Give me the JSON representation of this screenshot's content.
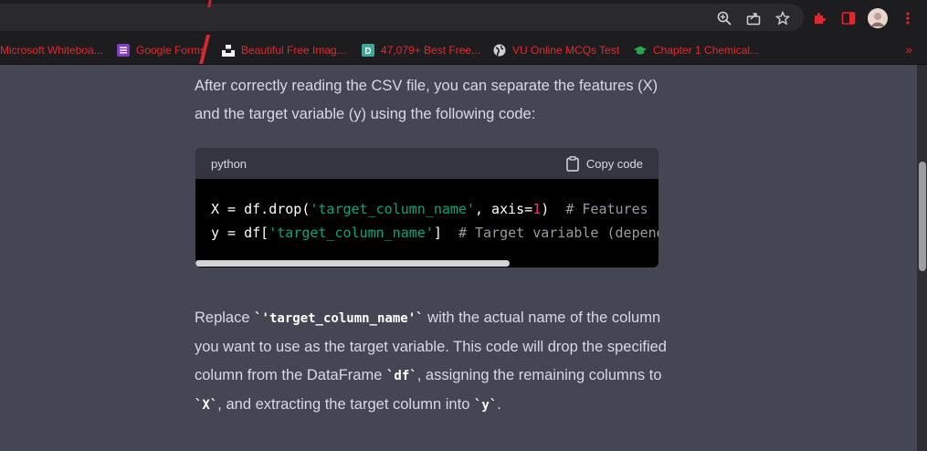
{
  "toolbar": {
    "icons": [
      "zoom-icon",
      "share-icon",
      "star-icon",
      "extension-icon",
      "sidebar-icon",
      "avatar",
      "menu-icon"
    ]
  },
  "bookmarks": [
    {
      "label": "Microsoft Whiteboa...",
      "icon": "none"
    },
    {
      "label": "Google Forms",
      "icon": "forms-icon"
    },
    {
      "label": "Beautiful Free Imag...",
      "icon": "unsplash-icon"
    },
    {
      "label": "47,079+ Best Free...",
      "icon": "d-icon"
    },
    {
      "label": "VU Online MCQs Test",
      "icon": "globe-icon"
    },
    {
      "label": "Chapter 1 Chemical...",
      "icon": "cap-icon"
    }
  ],
  "content": {
    "intro": "After correctly reading the CSV file, you can separate the features (X) and the target variable (y) using the following code:",
    "code": {
      "language": "python",
      "copy_label": "Copy code",
      "line1": {
        "a": "X = df.drop(",
        "str": "'target_column_name'",
        "b": ", axis=",
        "num": "1",
        "c": ")  ",
        "comment": "# Features (independent"
      },
      "line2": {
        "a": "y = df[",
        "str": "'target_column_name'",
        "b": "]  ",
        "comment": "# Target variable (dependent)"
      }
    },
    "outro": {
      "t1": "Replace ",
      "c1": "`'target_column_name'`",
      "t2": " with the actual name of the column you want to use as the target variable. This code will drop the specified column from the DataFrame ",
      "c2": "`df`",
      "t3": ", assigning the remaining columns to ",
      "c3": "`X`",
      "t4": ", and extracting the target column into ",
      "c4": "`y`",
      "t5": "."
    }
  },
  "colors": {
    "background": "#444654",
    "bookmark_text": "#e2282f",
    "code_string": "#00a67d",
    "code_number": "#df3079"
  }
}
